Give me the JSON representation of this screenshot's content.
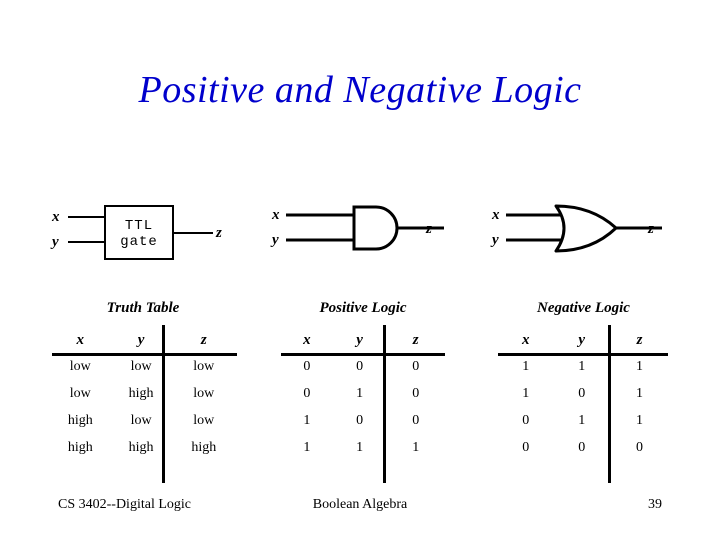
{
  "slide": {
    "title": "Positive and Negative Logic",
    "title_color": "#0000CC",
    "background_color": "#FFFFFF"
  },
  "diagrams": [
    {
      "kind": "block-box",
      "box_label_line1": "TTL",
      "box_label_line2": "gate",
      "input_x": "x",
      "input_y": "y",
      "output_z": "z"
    },
    {
      "kind": "and-gate",
      "input_x": "x",
      "input_y": "y",
      "output_z": "z"
    },
    {
      "kind": "or-gate",
      "input_x": "x",
      "input_y": "y",
      "output_z": "z"
    }
  ],
  "tables": {
    "truth": {
      "title": "Truth Table",
      "columns": [
        "x",
        "y",
        "z"
      ],
      "rows": [
        [
          "low",
          "low",
          "low"
        ],
        [
          "low",
          "high",
          "low"
        ],
        [
          "high",
          "low",
          "low"
        ],
        [
          "high",
          "high",
          "high"
        ]
      ]
    },
    "positive": {
      "title": "Positive Logic",
      "columns": [
        "x",
        "y",
        "z"
      ],
      "rows": [
        [
          "0",
          "0",
          "0"
        ],
        [
          "0",
          "1",
          "0"
        ],
        [
          "1",
          "0",
          "0"
        ],
        [
          "1",
          "1",
          "1"
        ]
      ]
    },
    "negative": {
      "title": "Negative Logic",
      "columns": [
        "x",
        "y",
        "z"
      ],
      "rows": [
        [
          "1",
          "1",
          "1"
        ],
        [
          "1",
          "0",
          "1"
        ],
        [
          "0",
          "1",
          "1"
        ],
        [
          "0",
          "0",
          "0"
        ]
      ]
    }
  },
  "footer": {
    "left": "CS 3402--Digital Logic",
    "center": "Boolean Algebra",
    "page_number": "39"
  }
}
